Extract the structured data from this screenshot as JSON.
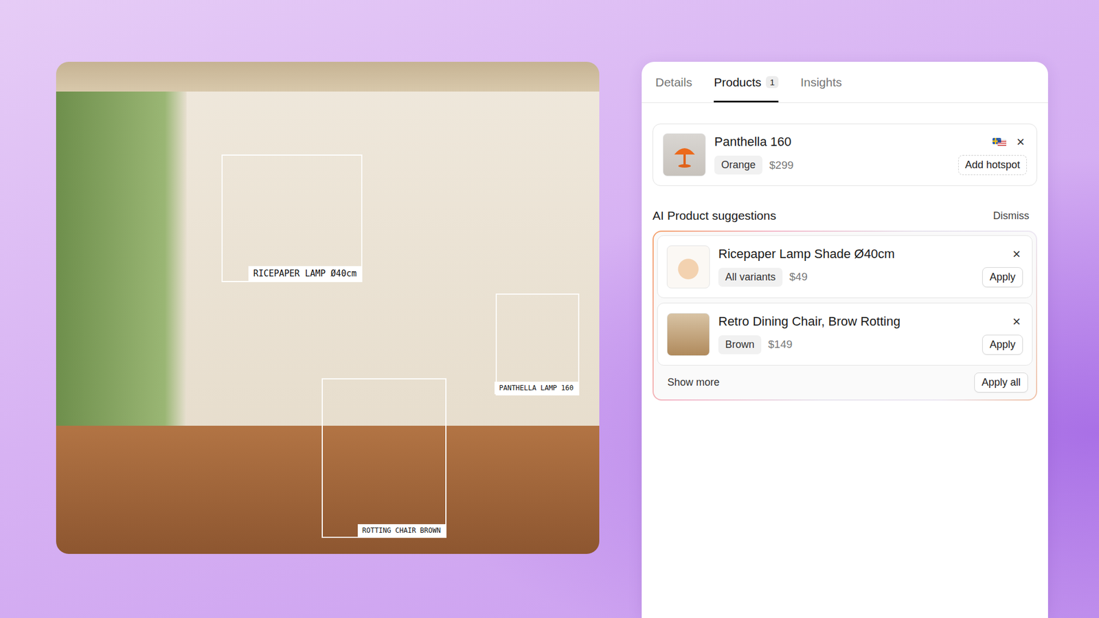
{
  "photo": {
    "hotspots": [
      {
        "label": "RICEPAPER LAMP Ø40cm"
      },
      {
        "label": "PANTHELLA LAMP 160"
      },
      {
        "label": "ROTTING CHAIR BROWN"
      }
    ]
  },
  "tabs": [
    {
      "label": "Details",
      "selected": false,
      "count": ""
    },
    {
      "label": "Products",
      "selected": true,
      "count": "1"
    },
    {
      "label": "Insights",
      "selected": false,
      "count": ""
    }
  ],
  "products": [
    {
      "name": "Panthella 160",
      "variant": "Orange",
      "price": "$299",
      "action": "Add hotspot",
      "remove": "×"
    }
  ],
  "suggestions": {
    "title": "AI Product suggestions",
    "dismiss": "Dismiss",
    "items": [
      {
        "name": "Ricepaper Lamp Shade Ø40cm",
        "variant": "All variants",
        "price": "$49",
        "action": "Apply",
        "remove": "×"
      },
      {
        "name": "Retro Dining Chair, Brow Rotting",
        "variant": "Brown",
        "price": "$149",
        "action": "Apply",
        "remove": "×"
      }
    ],
    "show_more": "Show more",
    "apply_all": "Apply all"
  }
}
